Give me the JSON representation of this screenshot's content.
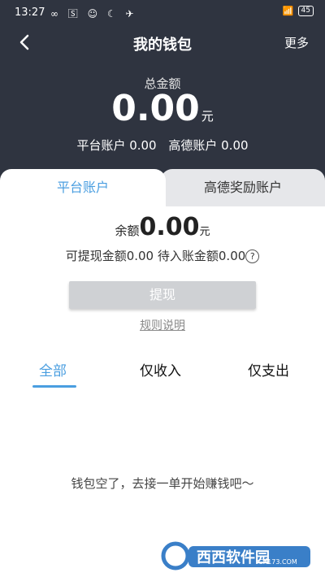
{
  "status": {
    "time": "13:27",
    "left_icons": "∞ 🅂 ☺ ☾ ✈",
    "signal": "📶",
    "battery": "45"
  },
  "nav": {
    "title": "我的钱包",
    "more": "更多"
  },
  "summary": {
    "total_label": "总金额",
    "total_amount": "0.00",
    "unit": "元",
    "platform_account": "平台账户 0.00",
    "gaode_account": "高德账户 0.00"
  },
  "tabs": {
    "active": "平台账户",
    "inactive": "高德奖励账户"
  },
  "balance": {
    "label": "余额",
    "amount": "0.00",
    "unit": "元",
    "withdrawable": "可提现金额0.00",
    "pending": "待入账金额0.00",
    "help": "?"
  },
  "actions": {
    "withdraw": "提现",
    "rules": "规则说明"
  },
  "filters": {
    "all": "全部",
    "income": "仅收入",
    "expense": "仅支出"
  },
  "empty_text": "钱包空了，去接一单开始赚钱吧～",
  "watermark": {
    "brand": "西西软件园",
    "url": "CR173.COM"
  }
}
